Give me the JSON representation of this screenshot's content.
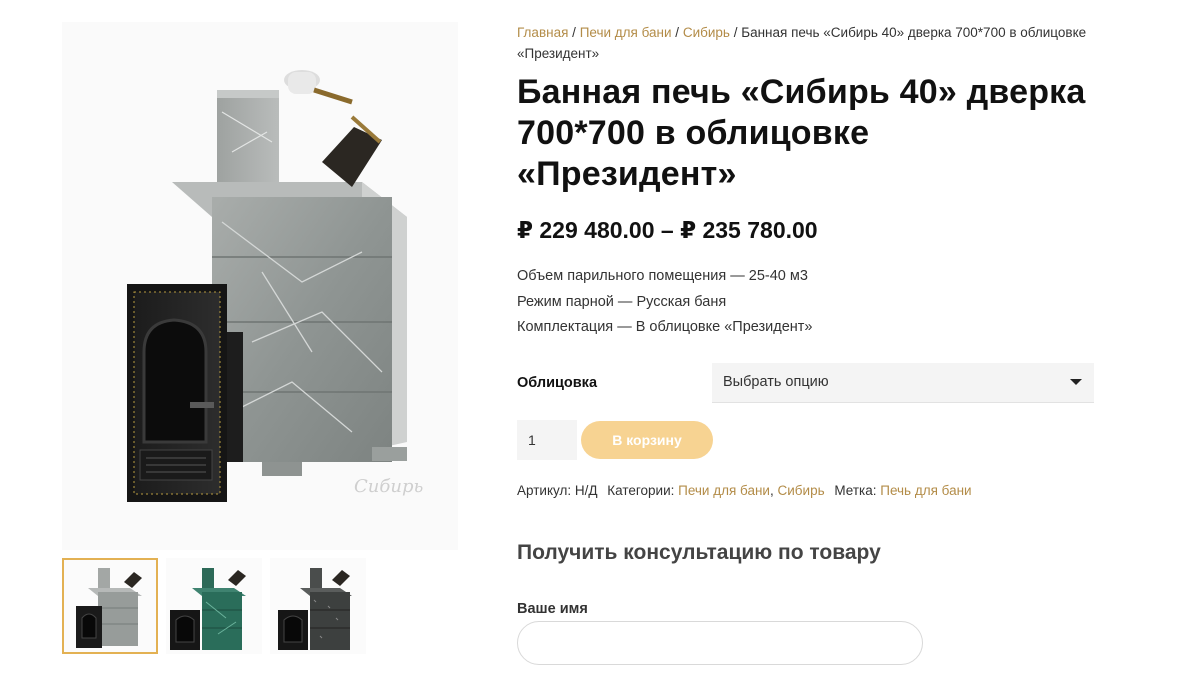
{
  "breadcrumb": {
    "home": "Главная",
    "sep": "/",
    "cat1": "Печи для бани",
    "cat2": "Сибирь",
    "current": "Банная печь «Сибирь 40» дверка 700*700 в облицовке «Президент»"
  },
  "product": {
    "title": "Банная печь «Сибирь 40» дверка 700*700 в облицовке «Президент»",
    "price": "₽ 229 480.00 – ₽ 235 780.00",
    "specs": [
      "Объем парильного помещения — 25-40 м3",
      "Режим парной — Русская баня",
      "Комплектация — В облицовке «Президент»"
    ],
    "option_label": "Облицовка",
    "option_value": "Выбрать опцию",
    "qty": "1",
    "add_to_cart": "В корзину",
    "meta": {
      "sku_label": "Артикул:",
      "sku": "Н/Д",
      "categories_label": "Категории:",
      "categories": [
        "Печи для бани",
        "Сибирь"
      ],
      "tag_label": "Метка:",
      "tag": "Печь для бани"
    }
  },
  "image": {
    "watermark": "Сибирь",
    "thumbnails": [
      "grey-stone",
      "green-serpentinite",
      "dark-granite"
    ]
  },
  "consult": {
    "heading": "Получить консультацию по товару",
    "name_label": "Ваше имя",
    "name_value": ""
  },
  "colors": {
    "link": "#b38c48",
    "button": "#f7d392",
    "thumb_active": "#e3b153"
  }
}
